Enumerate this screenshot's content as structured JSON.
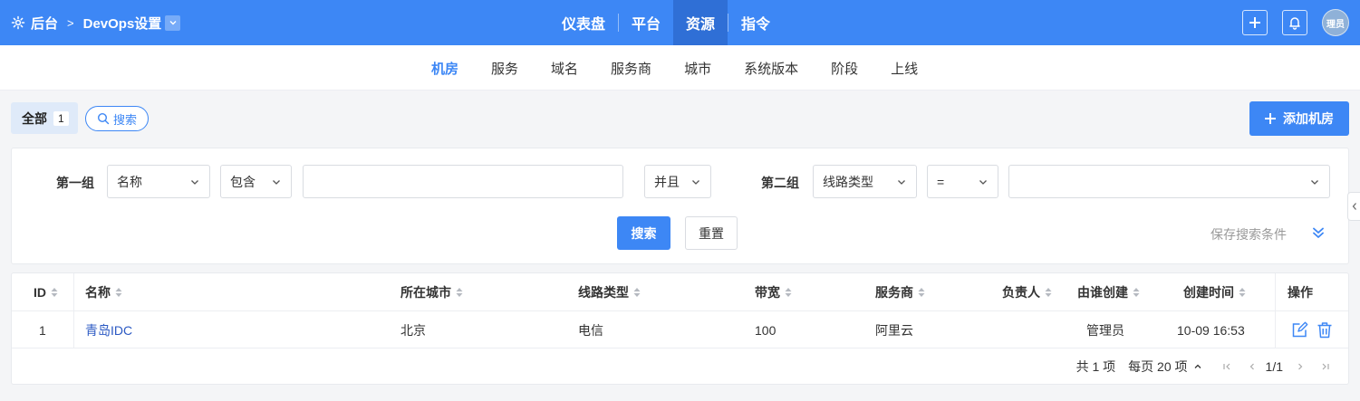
{
  "topbar": {
    "home_label": "后台",
    "project_label": "DevOps设置",
    "nav": [
      {
        "label": "仪表盘"
      },
      {
        "label": "平台"
      },
      {
        "label": "资源",
        "active": true
      },
      {
        "label": "指令"
      }
    ],
    "avatar_text": "理员"
  },
  "subnav": {
    "tabs": [
      {
        "label": "机房",
        "active": true
      },
      {
        "label": "服务"
      },
      {
        "label": "域名"
      },
      {
        "label": "服务商"
      },
      {
        "label": "城市"
      },
      {
        "label": "系统版本"
      },
      {
        "label": "阶段"
      },
      {
        "label": "上线"
      }
    ]
  },
  "filterbar": {
    "all_label": "全部",
    "all_count": "1",
    "search_chip": "搜索",
    "add_button": "添加机房"
  },
  "search": {
    "group1_label": "第一组",
    "group1_field": "名称",
    "group1_op": "包含",
    "group1_value": "",
    "logic": "并且",
    "group2_label": "第二组",
    "group2_field": "线路类型",
    "group2_op": "=",
    "group2_value": "",
    "search_button": "搜索",
    "reset_button": "重置",
    "save_conditions": "保存搜索条件"
  },
  "table": {
    "columns": [
      "ID",
      "名称",
      "所在城市",
      "线路类型",
      "带宽",
      "服务商",
      "负责人",
      "由谁创建",
      "创建时间",
      "操作"
    ],
    "rows": [
      {
        "id": "1",
        "name": "青岛IDC",
        "city": "北京",
        "line": "电信",
        "bandwidth": "100",
        "provider": "阿里云",
        "owner": "",
        "creator": "管理员",
        "created": "10-09 16:53"
      }
    ]
  },
  "pager": {
    "total": "共 1 项",
    "per_page": "每页 20 项",
    "page": "1/1"
  },
  "colors": {
    "primary": "#3d87f5",
    "link": "#2b59c3"
  }
}
